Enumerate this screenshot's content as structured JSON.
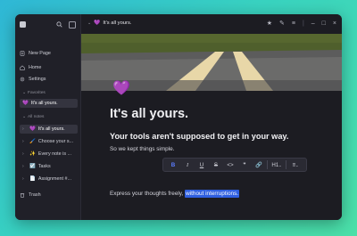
{
  "sidebar": {
    "new_page": "New Page",
    "home": "Home",
    "settings": "Settings",
    "favorites_label": "Favorites",
    "favorites": [
      {
        "emoji": "💜",
        "label": "It's all yours."
      }
    ],
    "all_notes_label": "All notes",
    "notes": [
      {
        "emoji": "💜",
        "label": "It's all yours."
      },
      {
        "emoji": "🖌️",
        "label": "Choose your s..."
      },
      {
        "emoji": "✨",
        "label": "Every note is ..."
      },
      {
        "emoji": "☑️",
        "label": "Tasks"
      },
      {
        "emoji": "📄",
        "label": "Assignment #..."
      }
    ],
    "trash": "Trash"
  },
  "titlebar": {
    "emoji": "💜",
    "title": "It's all yours."
  },
  "page": {
    "emoji": "💜",
    "heading": "It's all yours.",
    "subheading": "Your tools aren't supposed to get in your way.",
    "paragraph1": "So we kept things simple.",
    "paragraph2_plain": "Express your thoughts freely, ",
    "paragraph2_selected": "without interruptions."
  },
  "toolbar": {
    "bold": "B",
    "italic": "I",
    "underline": "U",
    "strike": "S",
    "code": "<>",
    "heading": "H1",
    "list": "≡"
  },
  "colors": {
    "accent": "#5b7cff",
    "selection": "#2f5fe0",
    "background": "#1e1e24"
  }
}
